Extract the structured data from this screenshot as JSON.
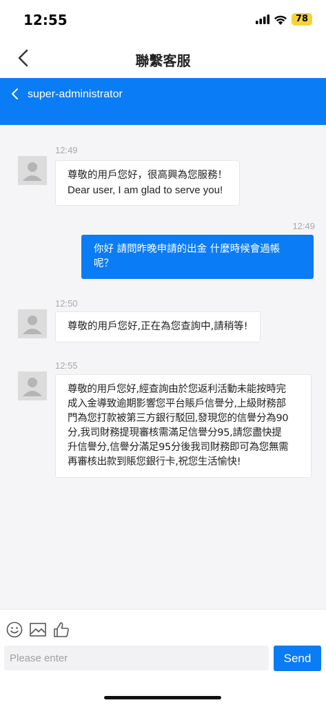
{
  "status_bar": {
    "time": "12:55",
    "battery": "78",
    "battery_color": "#f6d23a",
    "icons": [
      "cellular-signal-icon",
      "wifi-icon",
      "battery-icon"
    ]
  },
  "nav": {
    "title": "聯繫客服",
    "back_icon": "chevron-left-icon"
  },
  "chat_header": {
    "name": "super-administrator",
    "background": "#0a7cf5"
  },
  "messages": [
    {
      "direction": "incoming",
      "time": "12:49",
      "lines": [
        "尊敬的用戶您好，很高興為您服務！",
        "Dear user, I am glad to serve you!"
      ]
    },
    {
      "direction": "outgoing",
      "time": "12:49",
      "lines": [
        "你好 請問昨晚申請的出金 什麼時候會過帳",
        "呢？"
      ]
    },
    {
      "direction": "incoming",
      "time": "12:50",
      "lines": [
        "尊敬的用戶您好,正在為您查詢中,請稍等!"
      ]
    },
    {
      "direction": "incoming",
      "time": "12:55",
      "lines": [
        "尊敬的用戶您好,經查詢由於您返利活動未能按時完",
        "成入金導致逾期影響您平台賬戶信譽分,上級財務部",
        "門為您打款被第三方銀行駁回,發現您的信譽分為90",
        "分,我司財務提現審核需滿足信譽分95,請您盡快提",
        "升信譽分,信譽分滿足95分後我司財務即可為您無需",
        "再審核出款到賬您銀行卡,祝您生活愉快!"
      ]
    }
  ],
  "composer": {
    "tools": [
      "emoji-icon",
      "image-icon",
      "thumbs-up-icon"
    ],
    "placeholder": "Please enter",
    "value": "",
    "send_label": "Send"
  },
  "colors": {
    "accent": "#0a7cf5",
    "chat_background": "#f5f5f7",
    "timestamp": "#a9a9a9"
  }
}
